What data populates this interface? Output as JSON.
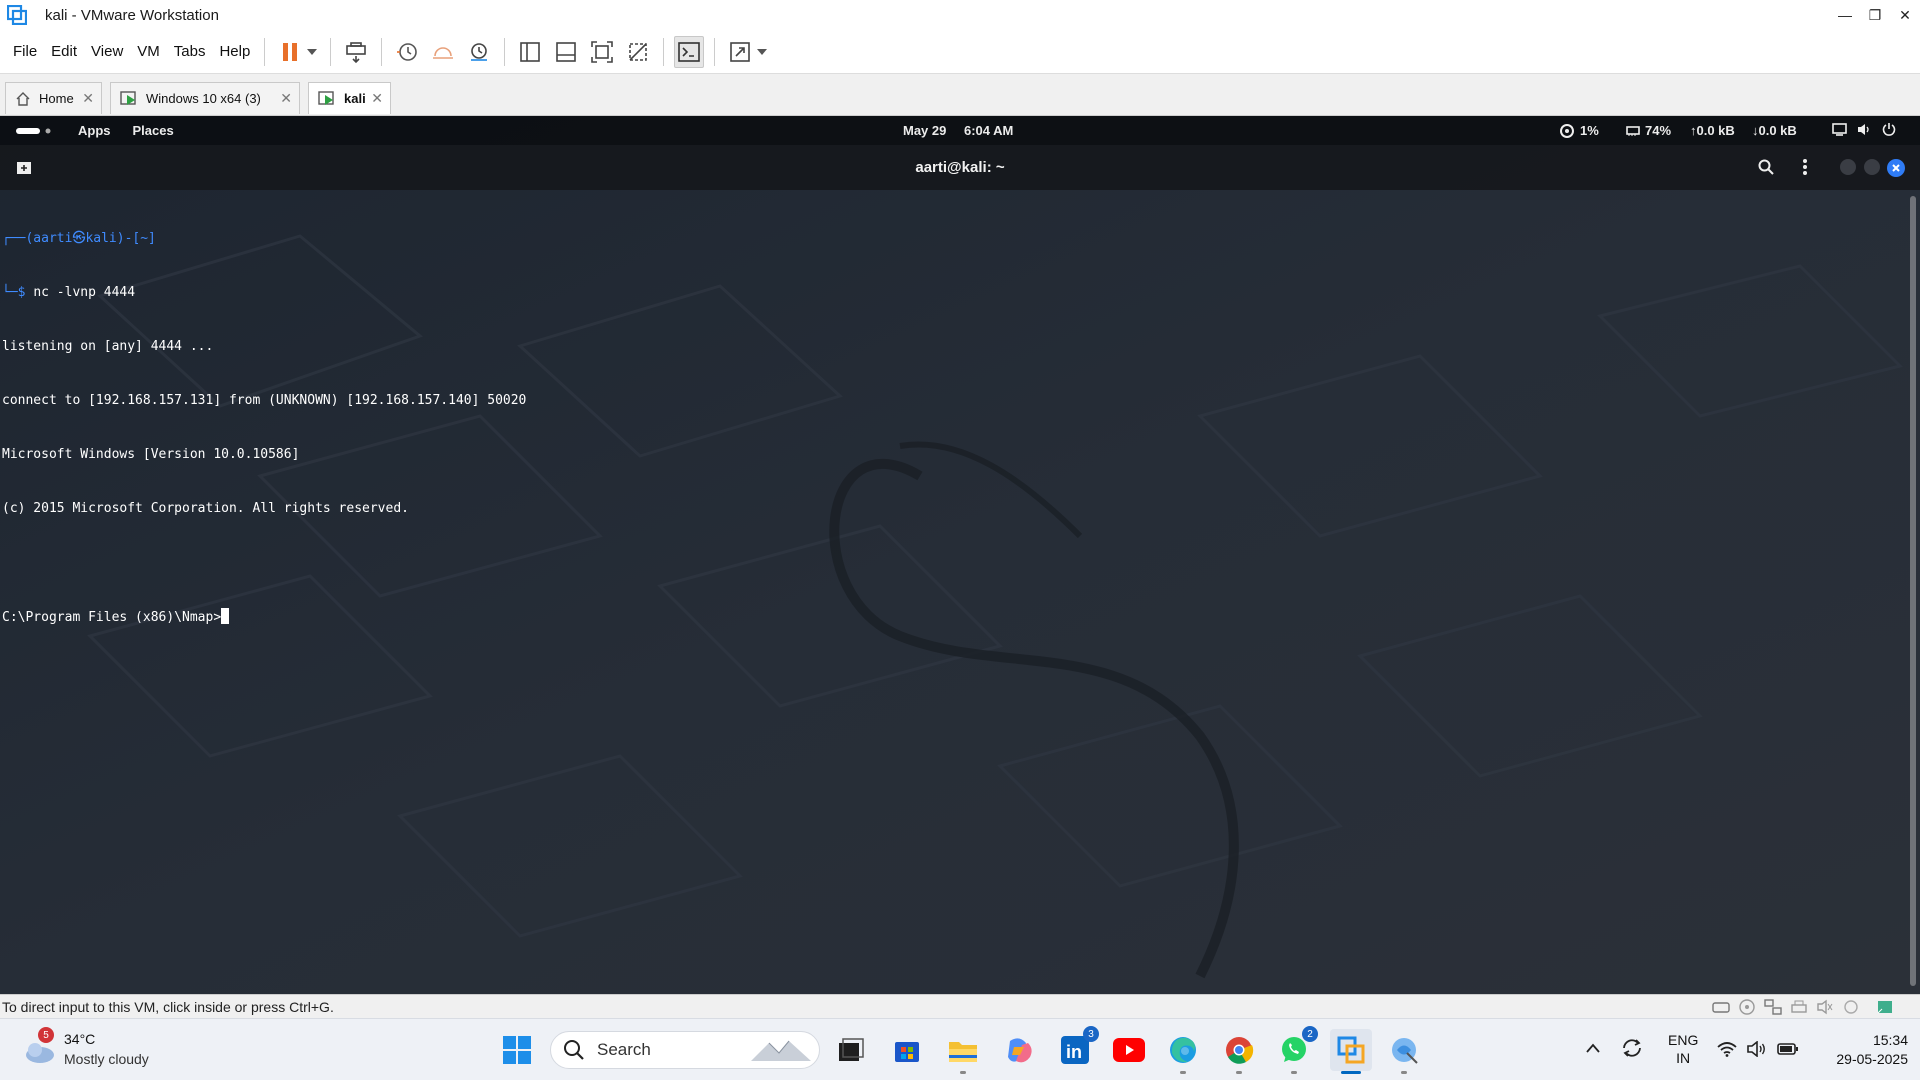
{
  "window": {
    "title": "kali - VMware Workstation"
  },
  "menubar": {
    "items": [
      "File",
      "Edit",
      "View",
      "VM",
      "Tabs",
      "Help"
    ]
  },
  "tabs": [
    {
      "label": "Home"
    },
    {
      "label": "Windows 10 x64 (3)"
    },
    {
      "label": "kali"
    }
  ],
  "kali_topbar": {
    "apps": "Apps",
    "places": "Places",
    "date": "May 29",
    "time": "6:04 AM",
    "cpu": "1%",
    "mem": "74%",
    "up": "0.0 kB",
    "down": "0.0 kB"
  },
  "terminal": {
    "title": "aarti@kali: ~",
    "prompt_user": "(aarti㉿kali)-[~]",
    "command": "nc -lvnp 4444",
    "lines": [
      "listening on [any] 4444 ...",
      "connect to [192.168.157.131] from (UNKNOWN) [192.168.157.140] 50020",
      "Microsoft Windows [Version 10.0.10586]",
      "(c) 2015 Microsoft Corporation. All rights reserved.",
      ""
    ],
    "current_prompt": "C:\\Program Files (x86)\\Nmap>"
  },
  "statusbar": {
    "text": "To direct input to this VM, click inside or press Ctrl+G."
  },
  "taskbar": {
    "weather_badge": "5",
    "temperature": "34°C",
    "condition": "Mostly cloudy",
    "search_placeholder": "Search",
    "linkedin_badge": "3",
    "whatsapp_badge": "2",
    "lang_top": "ENG",
    "lang_bottom": "IN",
    "clock_time": "15:34",
    "clock_date": "29-05-2025"
  },
  "colors": {
    "accent": "#0067c0",
    "prompt": "#3f8bff",
    "pause": "#e8702a"
  }
}
